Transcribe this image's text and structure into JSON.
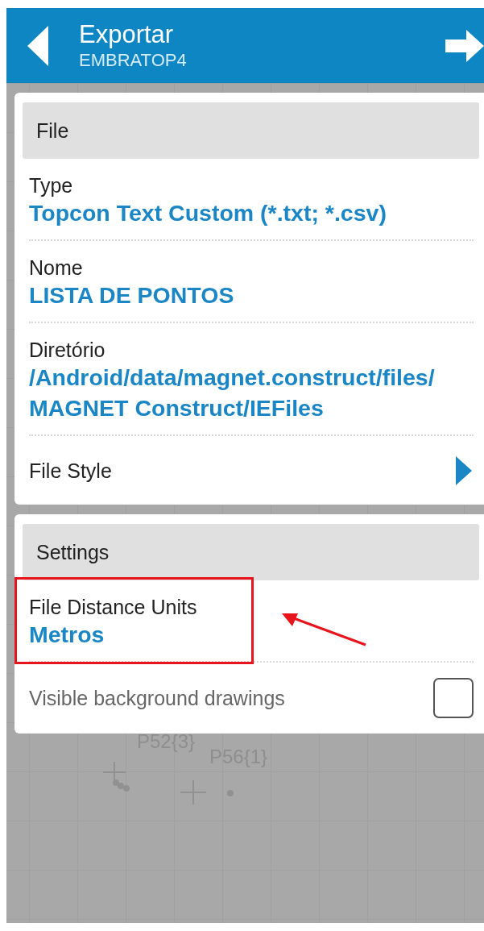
{
  "header": {
    "title": "Exportar",
    "subtitle": "EMBRATOP4"
  },
  "sections": [
    {
      "title": "File",
      "rows": [
        {
          "kind": "value",
          "label": "Type",
          "value": "Topcon Text Custom (*.txt; *.csv)",
          "highlighted": false
        },
        {
          "kind": "value",
          "label": "Nome",
          "value": "LISTA DE PONTOS",
          "highlighted": false
        },
        {
          "kind": "value",
          "label": "Diretório",
          "value": "/Android/data/magnet.construct/files/MAGNET Construct/IEFiles",
          "highlighted": false
        },
        {
          "kind": "link",
          "label": "File Style",
          "highlighted": false
        }
      ]
    },
    {
      "title": "Settings",
      "rows": [
        {
          "kind": "value",
          "label": "File Distance Units",
          "value": "Metros",
          "highlighted": true
        },
        {
          "kind": "checkbox",
          "label": "Visible background drawings",
          "checked": false,
          "highlighted": false
        }
      ]
    }
  ],
  "map_labels": [
    "P52{3}",
    "P56{1}"
  ]
}
